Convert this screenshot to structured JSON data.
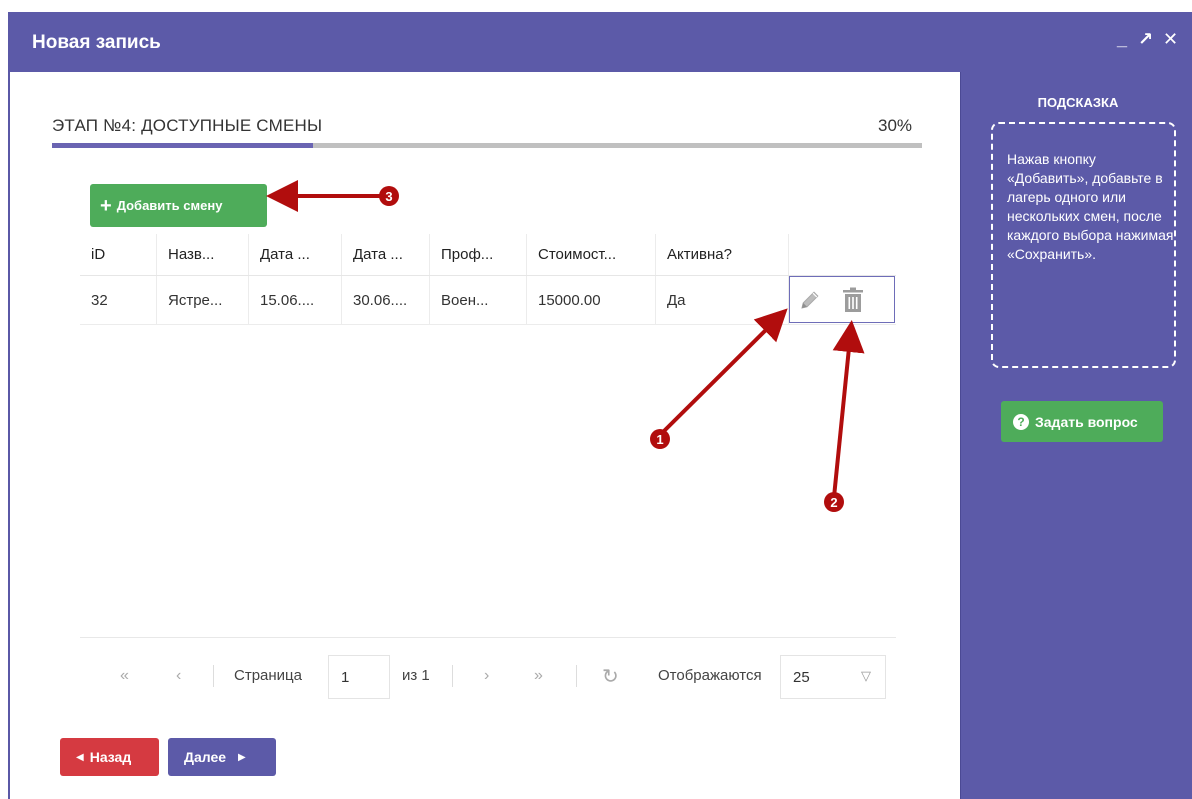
{
  "window": {
    "title": "Новая запись",
    "controls": {
      "minimize": "_",
      "maximize": "↗",
      "close": "✕"
    }
  },
  "stage": {
    "title": "ЭТАП №4: ДОСТУПНЫЕ СМЕНЫ",
    "percent_label": "30%",
    "progress": 0.3
  },
  "toolbar": {
    "add_label": "Добавить смену",
    "add_icon": "+"
  },
  "grid": {
    "headers": [
      "iD",
      "Назв...",
      "Дата ...",
      "Дата ...",
      "Проф...",
      "Стоимост...",
      "Активна?",
      ""
    ],
    "rows": [
      {
        "cells": [
          "32",
          "Ястре...",
          "15.06....",
          "30.06....",
          "Воен...",
          "15000.00",
          "Да"
        ]
      }
    ]
  },
  "pager": {
    "first": "«",
    "prev": "‹",
    "page_label": "Страница",
    "page_value": "1",
    "of_label": "из 1",
    "next": "›",
    "last": "»",
    "refresh": "↻",
    "shown_label": "Отображаются",
    "page_size": "25"
  },
  "nav": {
    "back_label": "Назад",
    "next_label": "Далее"
  },
  "hint": {
    "title": "ПОДСКАЗКА",
    "text": "Нажав кнопку «Добавить», добавьте в лагерь одного или нескольких смен, после каждого выбора нажимая «Сохранить».",
    "ask_label": "Задать вопрос"
  },
  "annotations": {
    "markers": [
      "1",
      "2",
      "3"
    ],
    "color": "#b10d0d"
  },
  "colors": {
    "accent": "#5c5aa8",
    "success": "#4eac5a",
    "danger": "#d53a41"
  }
}
